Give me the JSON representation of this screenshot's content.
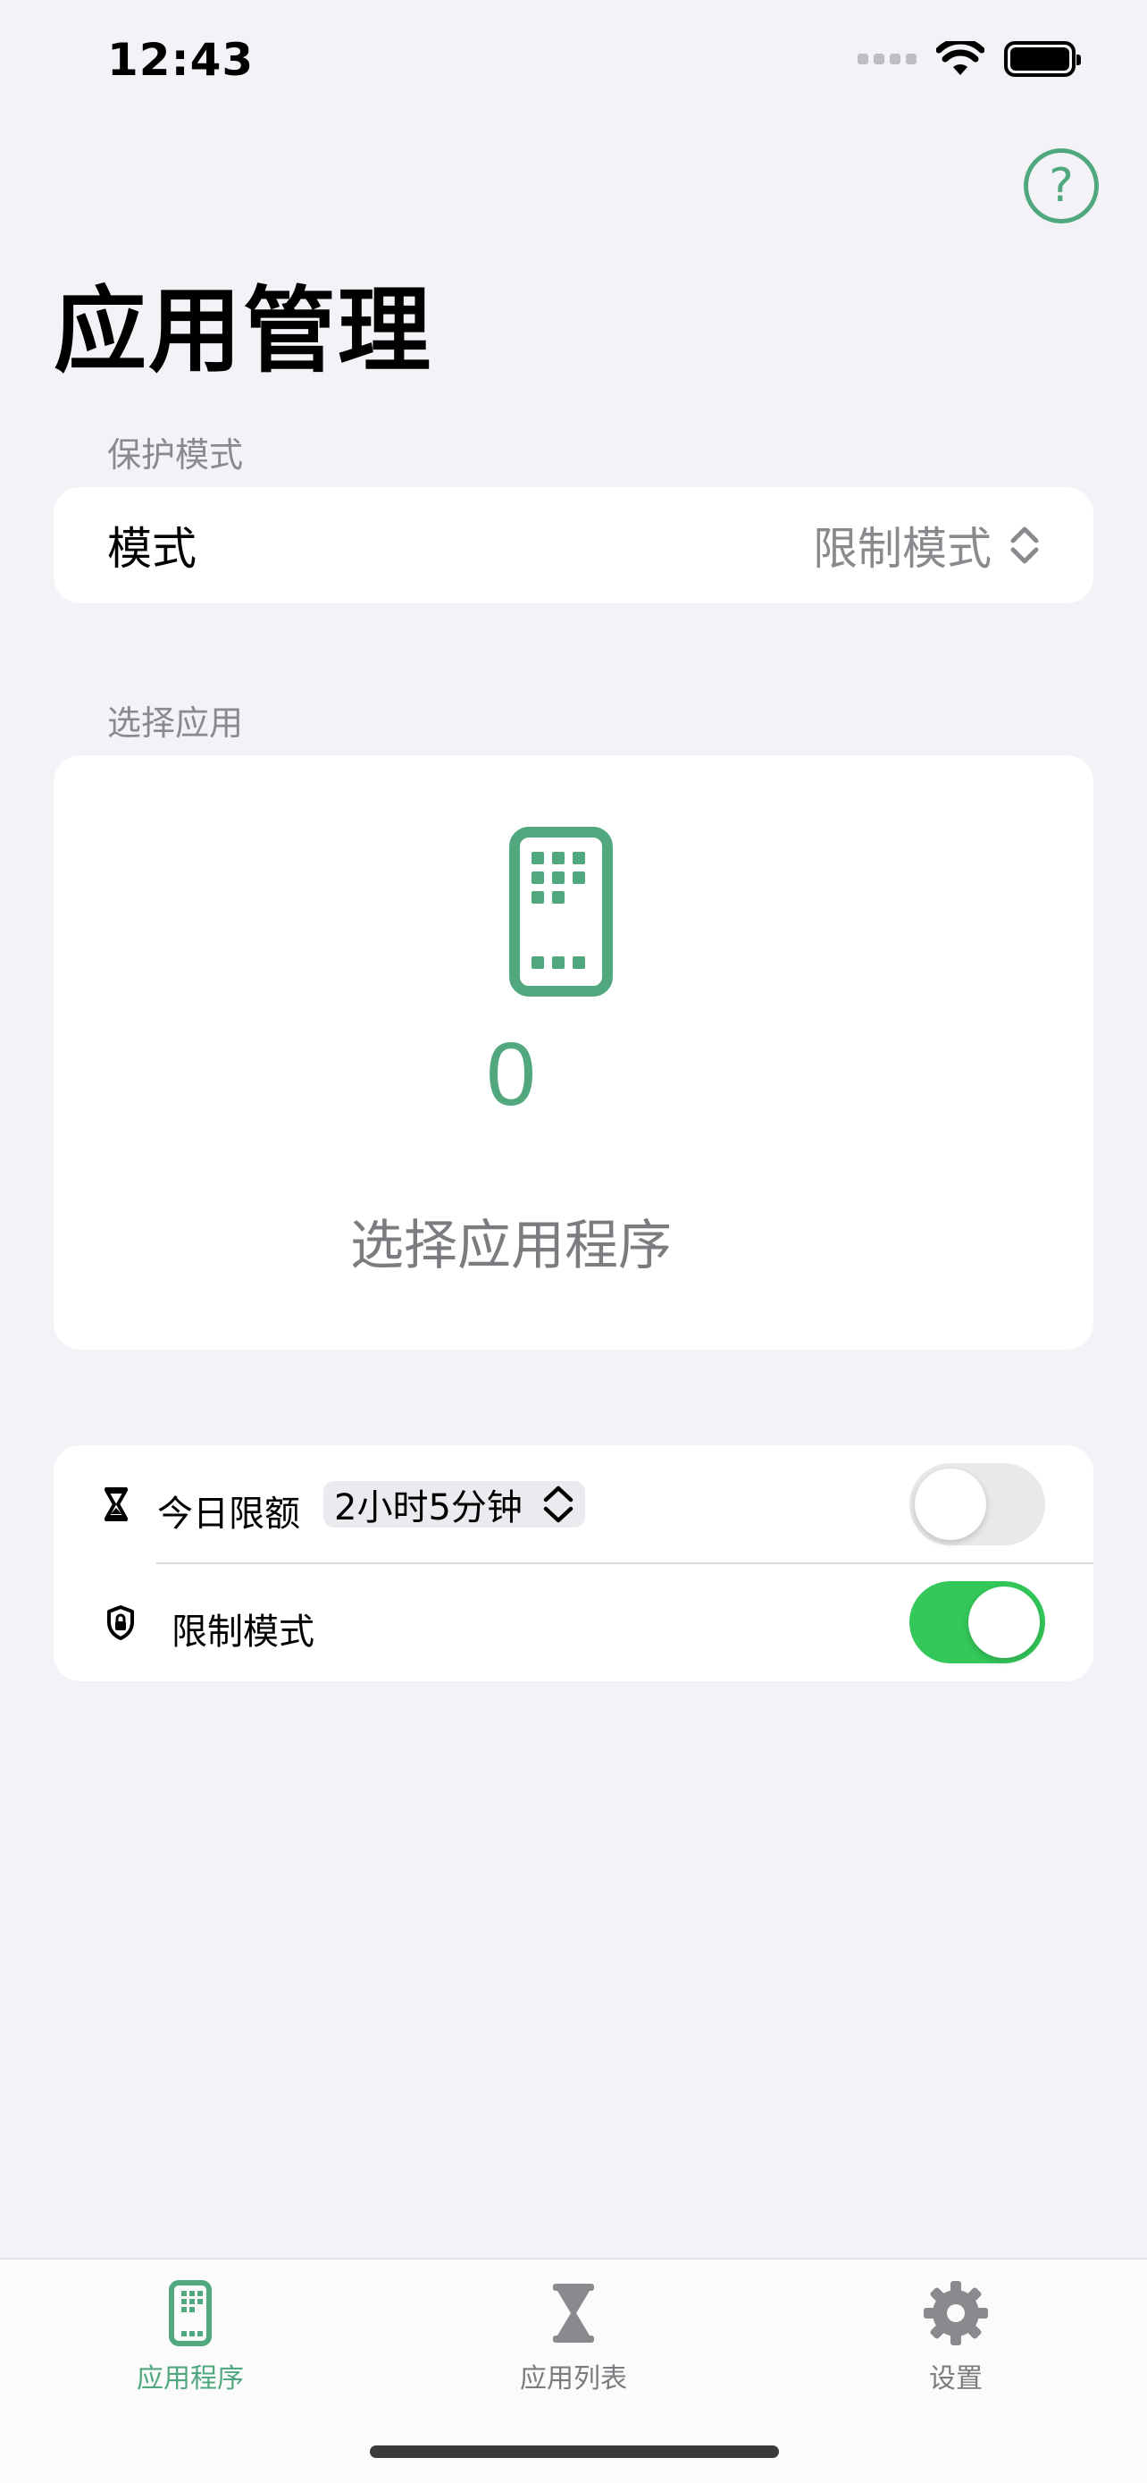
{
  "status_bar": {
    "time": "12:43"
  },
  "header": {
    "title": "应用管理",
    "help_icon": "question-circle-icon"
  },
  "protection": {
    "section_title": "保护模式",
    "mode_label": "模式",
    "mode_value": "限制模式"
  },
  "selection": {
    "section_title": "选择应用",
    "count": "0",
    "prompt": "选择应用程序"
  },
  "options": {
    "daily_limit": {
      "label": "今日限额",
      "value": "2小时5分钟",
      "enabled": false
    },
    "restrict_mode": {
      "label": "限制模式",
      "enabled": true
    }
  },
  "tab_bar": {
    "tabs": [
      {
        "label": "应用程序",
        "icon": "phone-grid-icon",
        "active": true
      },
      {
        "label": "应用列表",
        "icon": "hourglass-icon",
        "active": false
      },
      {
        "label": "设置",
        "icon": "gear-icon",
        "active": false
      }
    ]
  },
  "colors": {
    "accent": "#52A87E",
    "toggle_on": "#34C759",
    "background": "#F2F2F7"
  }
}
